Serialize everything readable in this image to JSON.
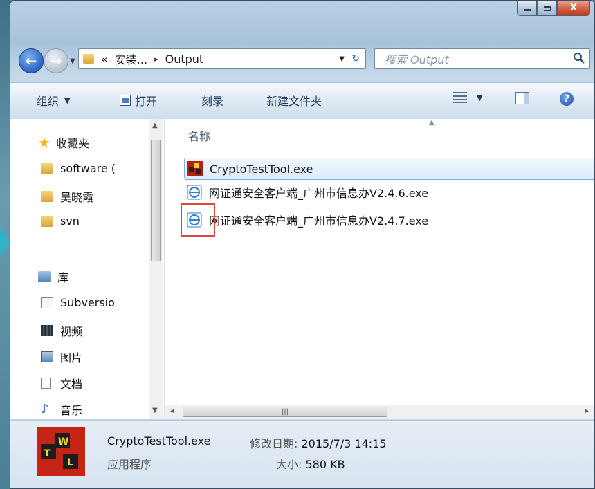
{
  "window": {
    "caption": {
      "minimize": "—",
      "maximize": "□",
      "close": "X"
    }
  },
  "address": {
    "overflow": "«",
    "crumb_parent": "安装...",
    "crumb_sep": "▸",
    "crumb_current": "Output",
    "search_placeholder": "搜索 Output"
  },
  "toolbar": {
    "organize": "组织",
    "open": "打开",
    "burn": "刻录",
    "new_folder": "新建文件夹"
  },
  "nav": {
    "favorites_label": "收藏夹",
    "favorites": [
      {
        "label": "software (",
        "icon": "folder-download-icon"
      },
      {
        "label": "吴晓霞",
        "icon": "folder-icon"
      },
      {
        "label": "svn",
        "icon": "folder-icon"
      }
    ],
    "library_label": "库",
    "libraries": [
      {
        "label": "Subversio",
        "icon": "document-library-icon"
      },
      {
        "label": "视频",
        "icon": "video-library-icon"
      },
      {
        "label": "图片",
        "icon": "picture-library-icon"
      },
      {
        "label": "文档",
        "icon": "document-icon"
      },
      {
        "label": "音乐",
        "icon": "music-icon"
      }
    ]
  },
  "files": {
    "column_name": "名称",
    "items": [
      {
        "name": "CryptoTestTool.exe",
        "icon": "cryptotool-exe-icon",
        "selected": true
      },
      {
        "name": "网证通安全客户端_广州市信息办V2.4.6.exe",
        "icon": "installer-exe-icon",
        "selected": false
      },
      {
        "name": "网证通安全客户端_广州市信息办V2.4.7.exe",
        "icon": "installer-exe-icon",
        "selected": false
      }
    ]
  },
  "details": {
    "name": "CryptoTestTool.exe",
    "type": "应用程序",
    "modified_label": "修改日期:",
    "modified_value": "2015/7/3 14:15",
    "size_label": "大小:",
    "size_value": "580 KB"
  },
  "colors": {
    "selection_border": "#84acdd",
    "highlight_box": "#e0473c",
    "toolbar_text": "#1e395b"
  }
}
